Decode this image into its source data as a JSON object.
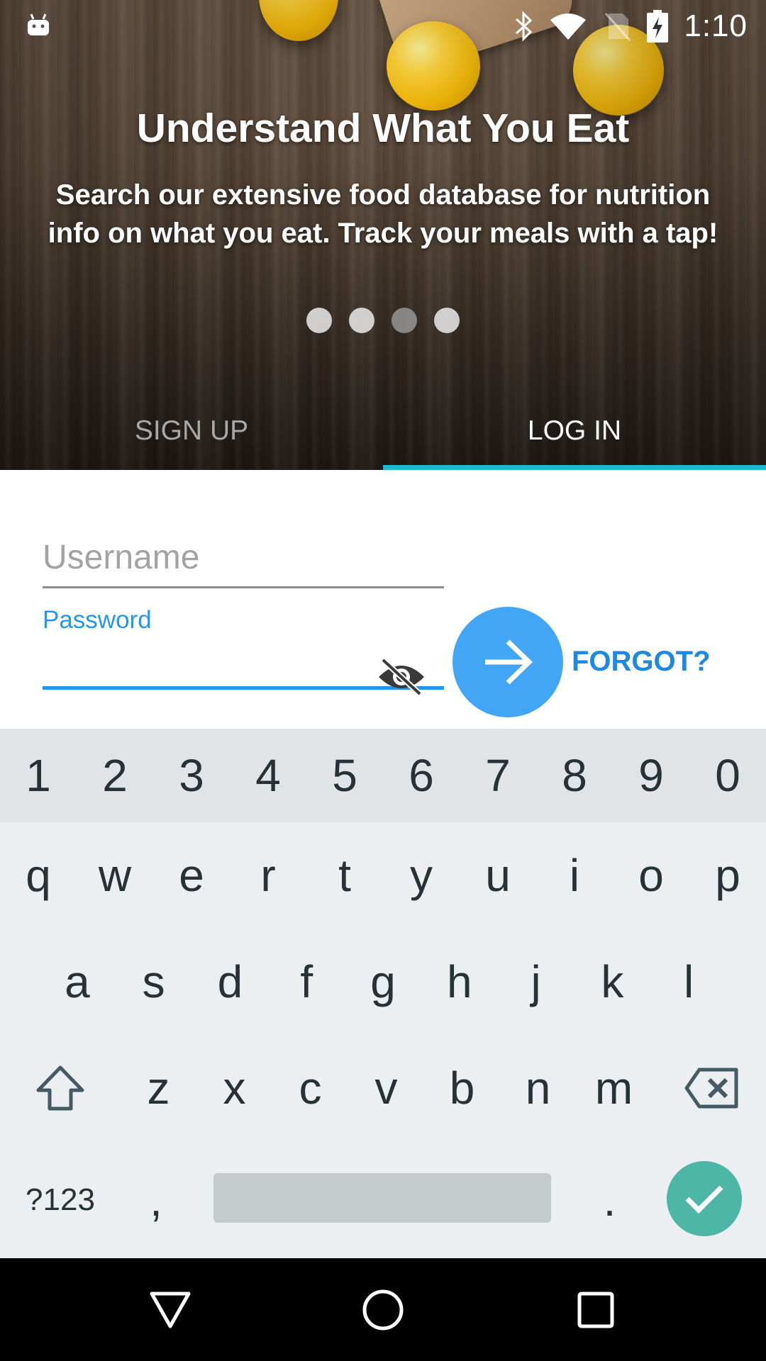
{
  "status_bar": {
    "time": "1:10",
    "icons": [
      "android-icon",
      "bluetooth-icon",
      "wifi-icon",
      "no-sim-icon",
      "battery-charging-icon"
    ]
  },
  "hero": {
    "title": "Understand What You Eat",
    "subtitle": "Search our extensive food database for nutrition info on what you eat.  Track your meals with a tap!",
    "pager": {
      "count": 4,
      "active_index": 2
    }
  },
  "tabs": [
    {
      "label": "SIGN UP",
      "active": false
    },
    {
      "label": "LOG IN",
      "active": true
    }
  ],
  "form": {
    "username": {
      "placeholder": "Username",
      "value": ""
    },
    "password": {
      "label": "Password",
      "value": ""
    },
    "forgot_label": "FORGOT?",
    "submit_icon": "arrow-right-icon"
  },
  "keyboard": {
    "numbers": [
      "1",
      "2",
      "3",
      "4",
      "5",
      "6",
      "7",
      "8",
      "9",
      "0"
    ],
    "row1": [
      "q",
      "w",
      "e",
      "r",
      "t",
      "y",
      "u",
      "i",
      "o",
      "p"
    ],
    "row2": [
      "a",
      "s",
      "d",
      "f",
      "g",
      "h",
      "j",
      "k",
      "l"
    ],
    "row3": [
      "z",
      "x",
      "c",
      "v",
      "b",
      "n",
      "m"
    ],
    "symbols_label": "?123",
    "comma": ",",
    "period": ".",
    "enter_icon": "checkmark-icon"
  },
  "nav": [
    "back-icon",
    "home-icon",
    "recents-icon"
  ],
  "colors": {
    "accent": "#2196f3",
    "tab_indicator": "#1fb6d4",
    "submit_button": "#42a5f5",
    "enter_key": "#4db6a6"
  }
}
